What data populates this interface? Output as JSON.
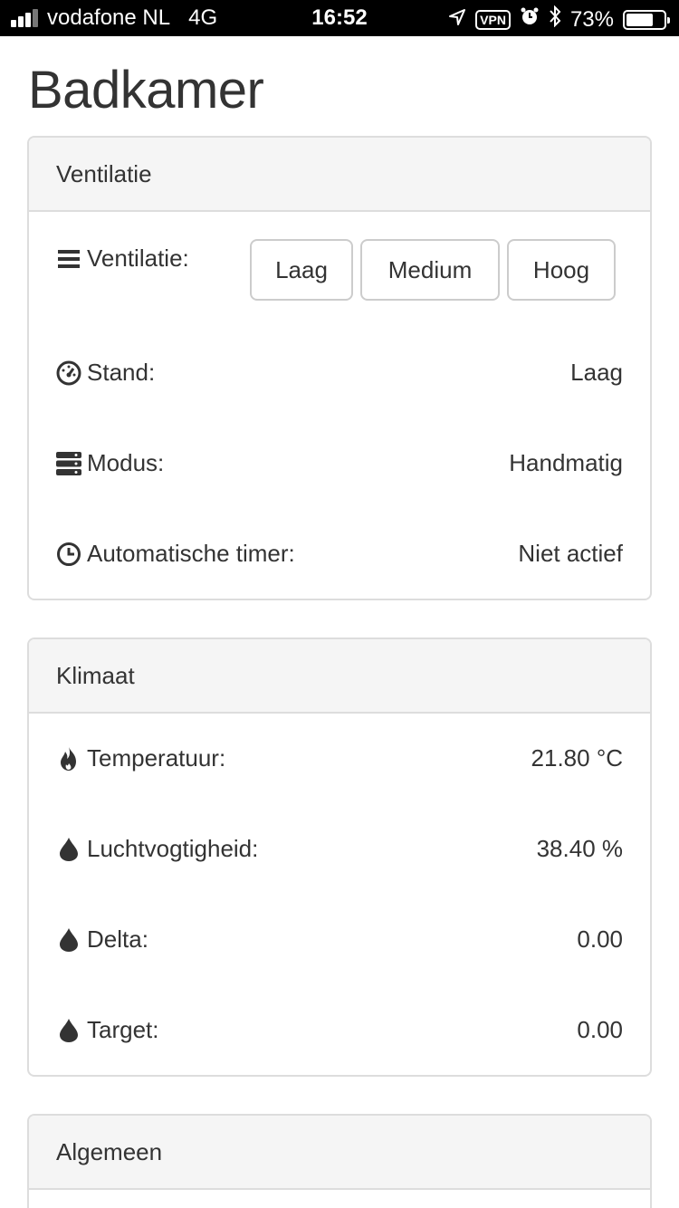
{
  "status_bar": {
    "carrier": "vodafone NL",
    "network": "4G",
    "time": "16:52",
    "vpn": "VPN",
    "battery_percent": "73%",
    "battery_level": 0.73,
    "signal_bars": 3,
    "signal_bars_max": 4
  },
  "page": {
    "title": "Badkamer"
  },
  "ventilatie": {
    "heading": "Ventilatie",
    "control": {
      "label": "Ventilatie:",
      "icon": "bars-icon",
      "buttons": [
        "Laag",
        "Medium",
        "Hoog"
      ]
    },
    "stand": {
      "label": "Stand:",
      "value": "Laag",
      "icon": "dashboard-icon"
    },
    "modus": {
      "label": "Modus:",
      "value": "Handmatig",
      "icon": "server-icon"
    },
    "timer": {
      "label": "Automatische timer:",
      "value": "Niet actief",
      "icon": "clock-icon"
    }
  },
  "klimaat": {
    "heading": "Klimaat",
    "temperatuur": {
      "label": "Temperatuur:",
      "value": "21.80 °C",
      "icon": "fire-icon"
    },
    "luchtvochtigheid": {
      "label": "Luchtvogtigheid:",
      "value": "38.40 %",
      "icon": "droplet-icon"
    },
    "delta": {
      "label": "Delta:",
      "value": "0.00",
      "icon": "droplet-icon"
    },
    "target": {
      "label": "Target:",
      "value": "0.00",
      "icon": "droplet-icon"
    }
  },
  "algemeen": {
    "heading": "Algemeen"
  },
  "colors": {
    "text": "#333333",
    "panel_heading_bg": "#f5f5f5",
    "border": "#dddddd",
    "status_bar_bg": "#000000"
  }
}
